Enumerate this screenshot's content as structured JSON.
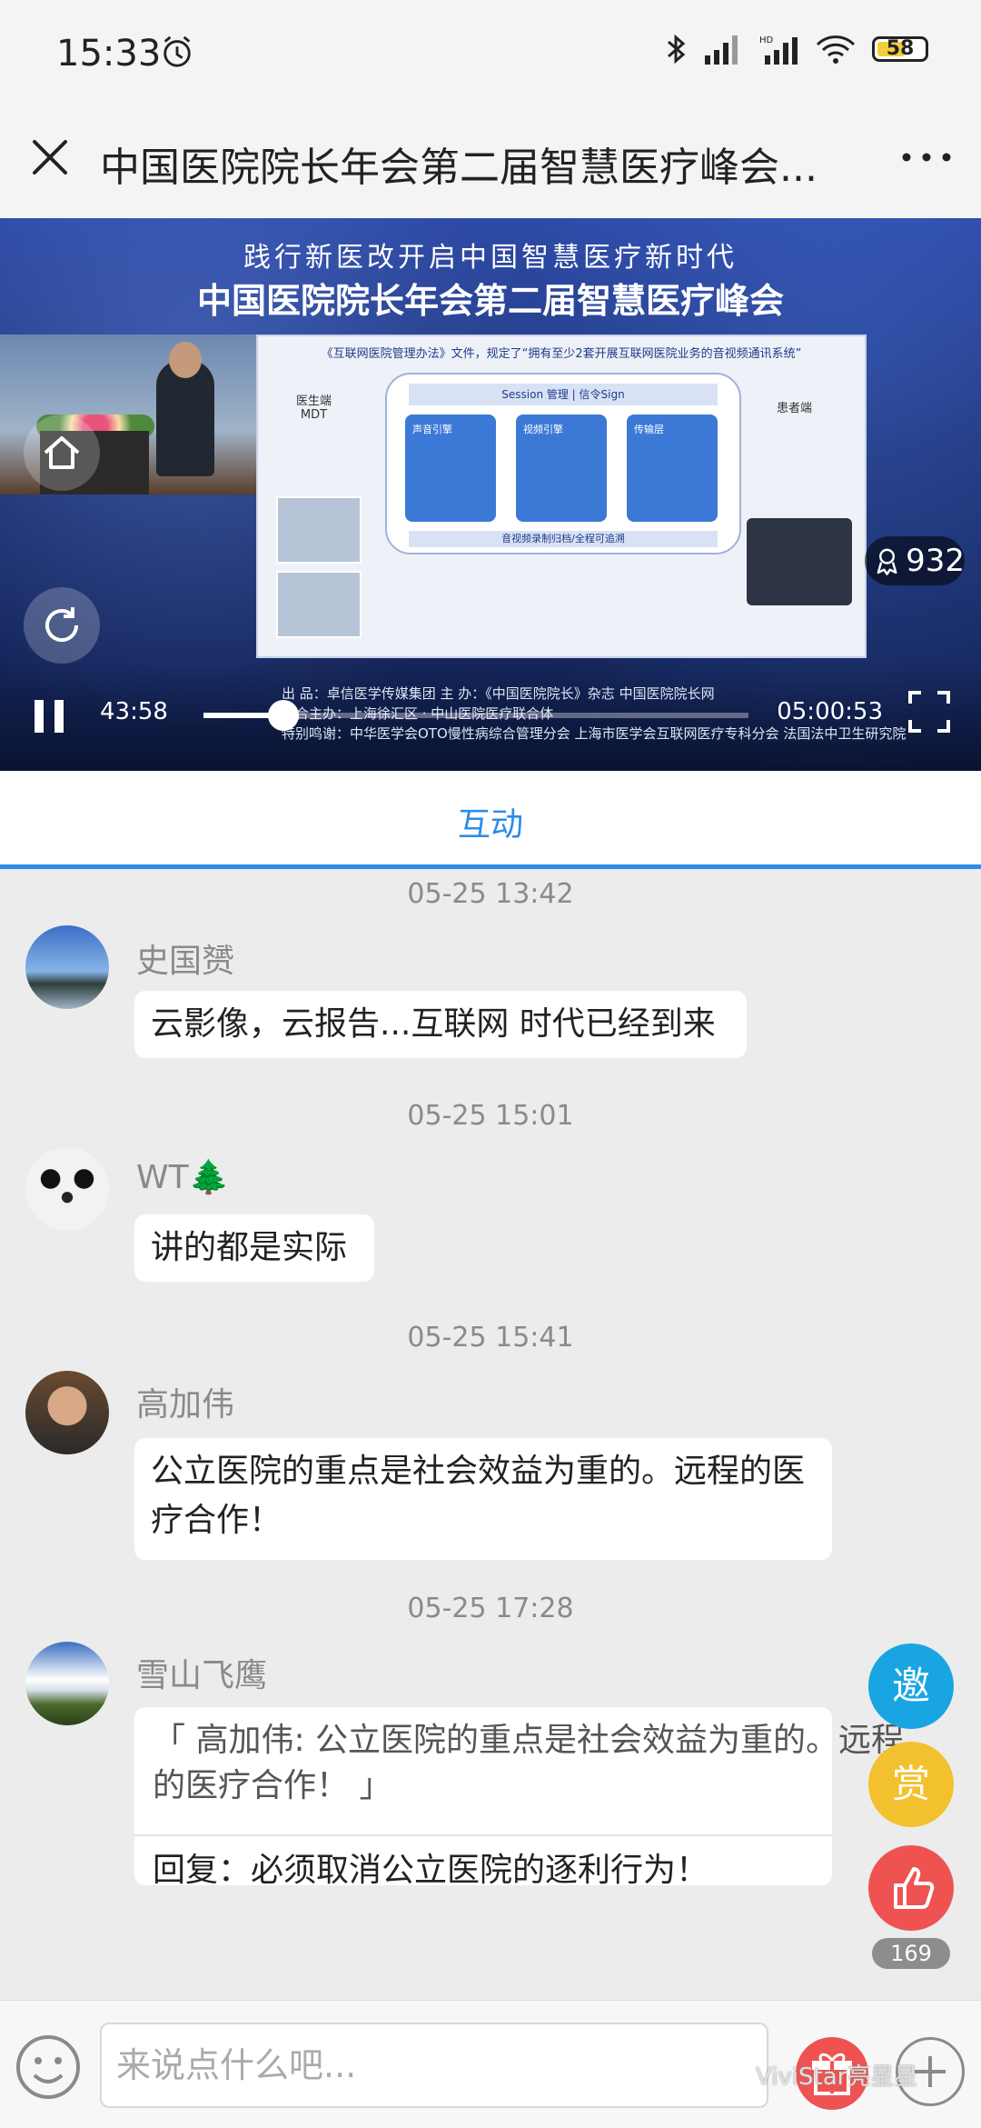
{
  "status_bar": {
    "time": "15:33",
    "battery": "58"
  },
  "header": {
    "title": "中国医院院长年会第二届智慧医疗峰会...",
    "close_icon": "close-icon",
    "more_icon": "more-icon"
  },
  "video": {
    "banner_sub": "践行新医改开启中国智慧医疗新时代",
    "banner_main": "中国医院院长年会第二届智慧医疗峰会",
    "viewers": "932",
    "current_time": "43:58",
    "total_time": "05:00:53",
    "progress": 0.146,
    "slide": {
      "header": "《互联网医院管理办法》文件，规定了“拥有至少2套开展互联网医院业务的音视频通讯系统”",
      "left_label": "医生端\nMDT",
      "right_label": "患者端",
      "session": "Session 管理 | 信令Sign",
      "box1": "声音引擎",
      "box2": "视频引擎",
      "box3": "传输层",
      "bottom": "音视频录制归档/全程可追溯"
    },
    "credits": [
      "出 品：卓信医学传媒集团   主 办：《中国医院院长》杂志   中国医院院长网",
      "联合主办：上海徐汇区 · 中山医院医疗联合体",
      "特别鸣谢：中华医学会OTO慢性病综合管理分会   上海市医学会互联网医疗专科分会   法国法中卫生研究院"
    ]
  },
  "tabs": {
    "interaction": "互动"
  },
  "messages": [
    {
      "time": "05-25 13:42",
      "user": "史国赟",
      "text": "云影像，云报告...互联网 时代已经到来"
    },
    {
      "time": "05-25 15:01",
      "user": "WT🌲",
      "text": "讲的都是实际"
    },
    {
      "time": "05-25 15:41",
      "user": "高加伟",
      "text": "公立医院的重点是社会效益为重的。远程的医疗合作！"
    },
    {
      "time": "05-25 17:28",
      "user": "雪山飞鹰",
      "quote": "「 高加伟: 公立医院的重点是社会效益为重的。远程的医疗合作！ 」",
      "reply": "回复：必须取消公立医院的逐利行为！"
    }
  ],
  "actions": {
    "invite": "邀",
    "reward": "赏",
    "like_count": "169"
  },
  "composer": {
    "placeholder": "来说点什么吧..."
  },
  "watermark": "ViviStar亮星星",
  "colors": {
    "accent": "#2a8de8",
    "invite": "#18a5e2",
    "reward": "#f3c12d",
    "like": "#ee5352"
  }
}
